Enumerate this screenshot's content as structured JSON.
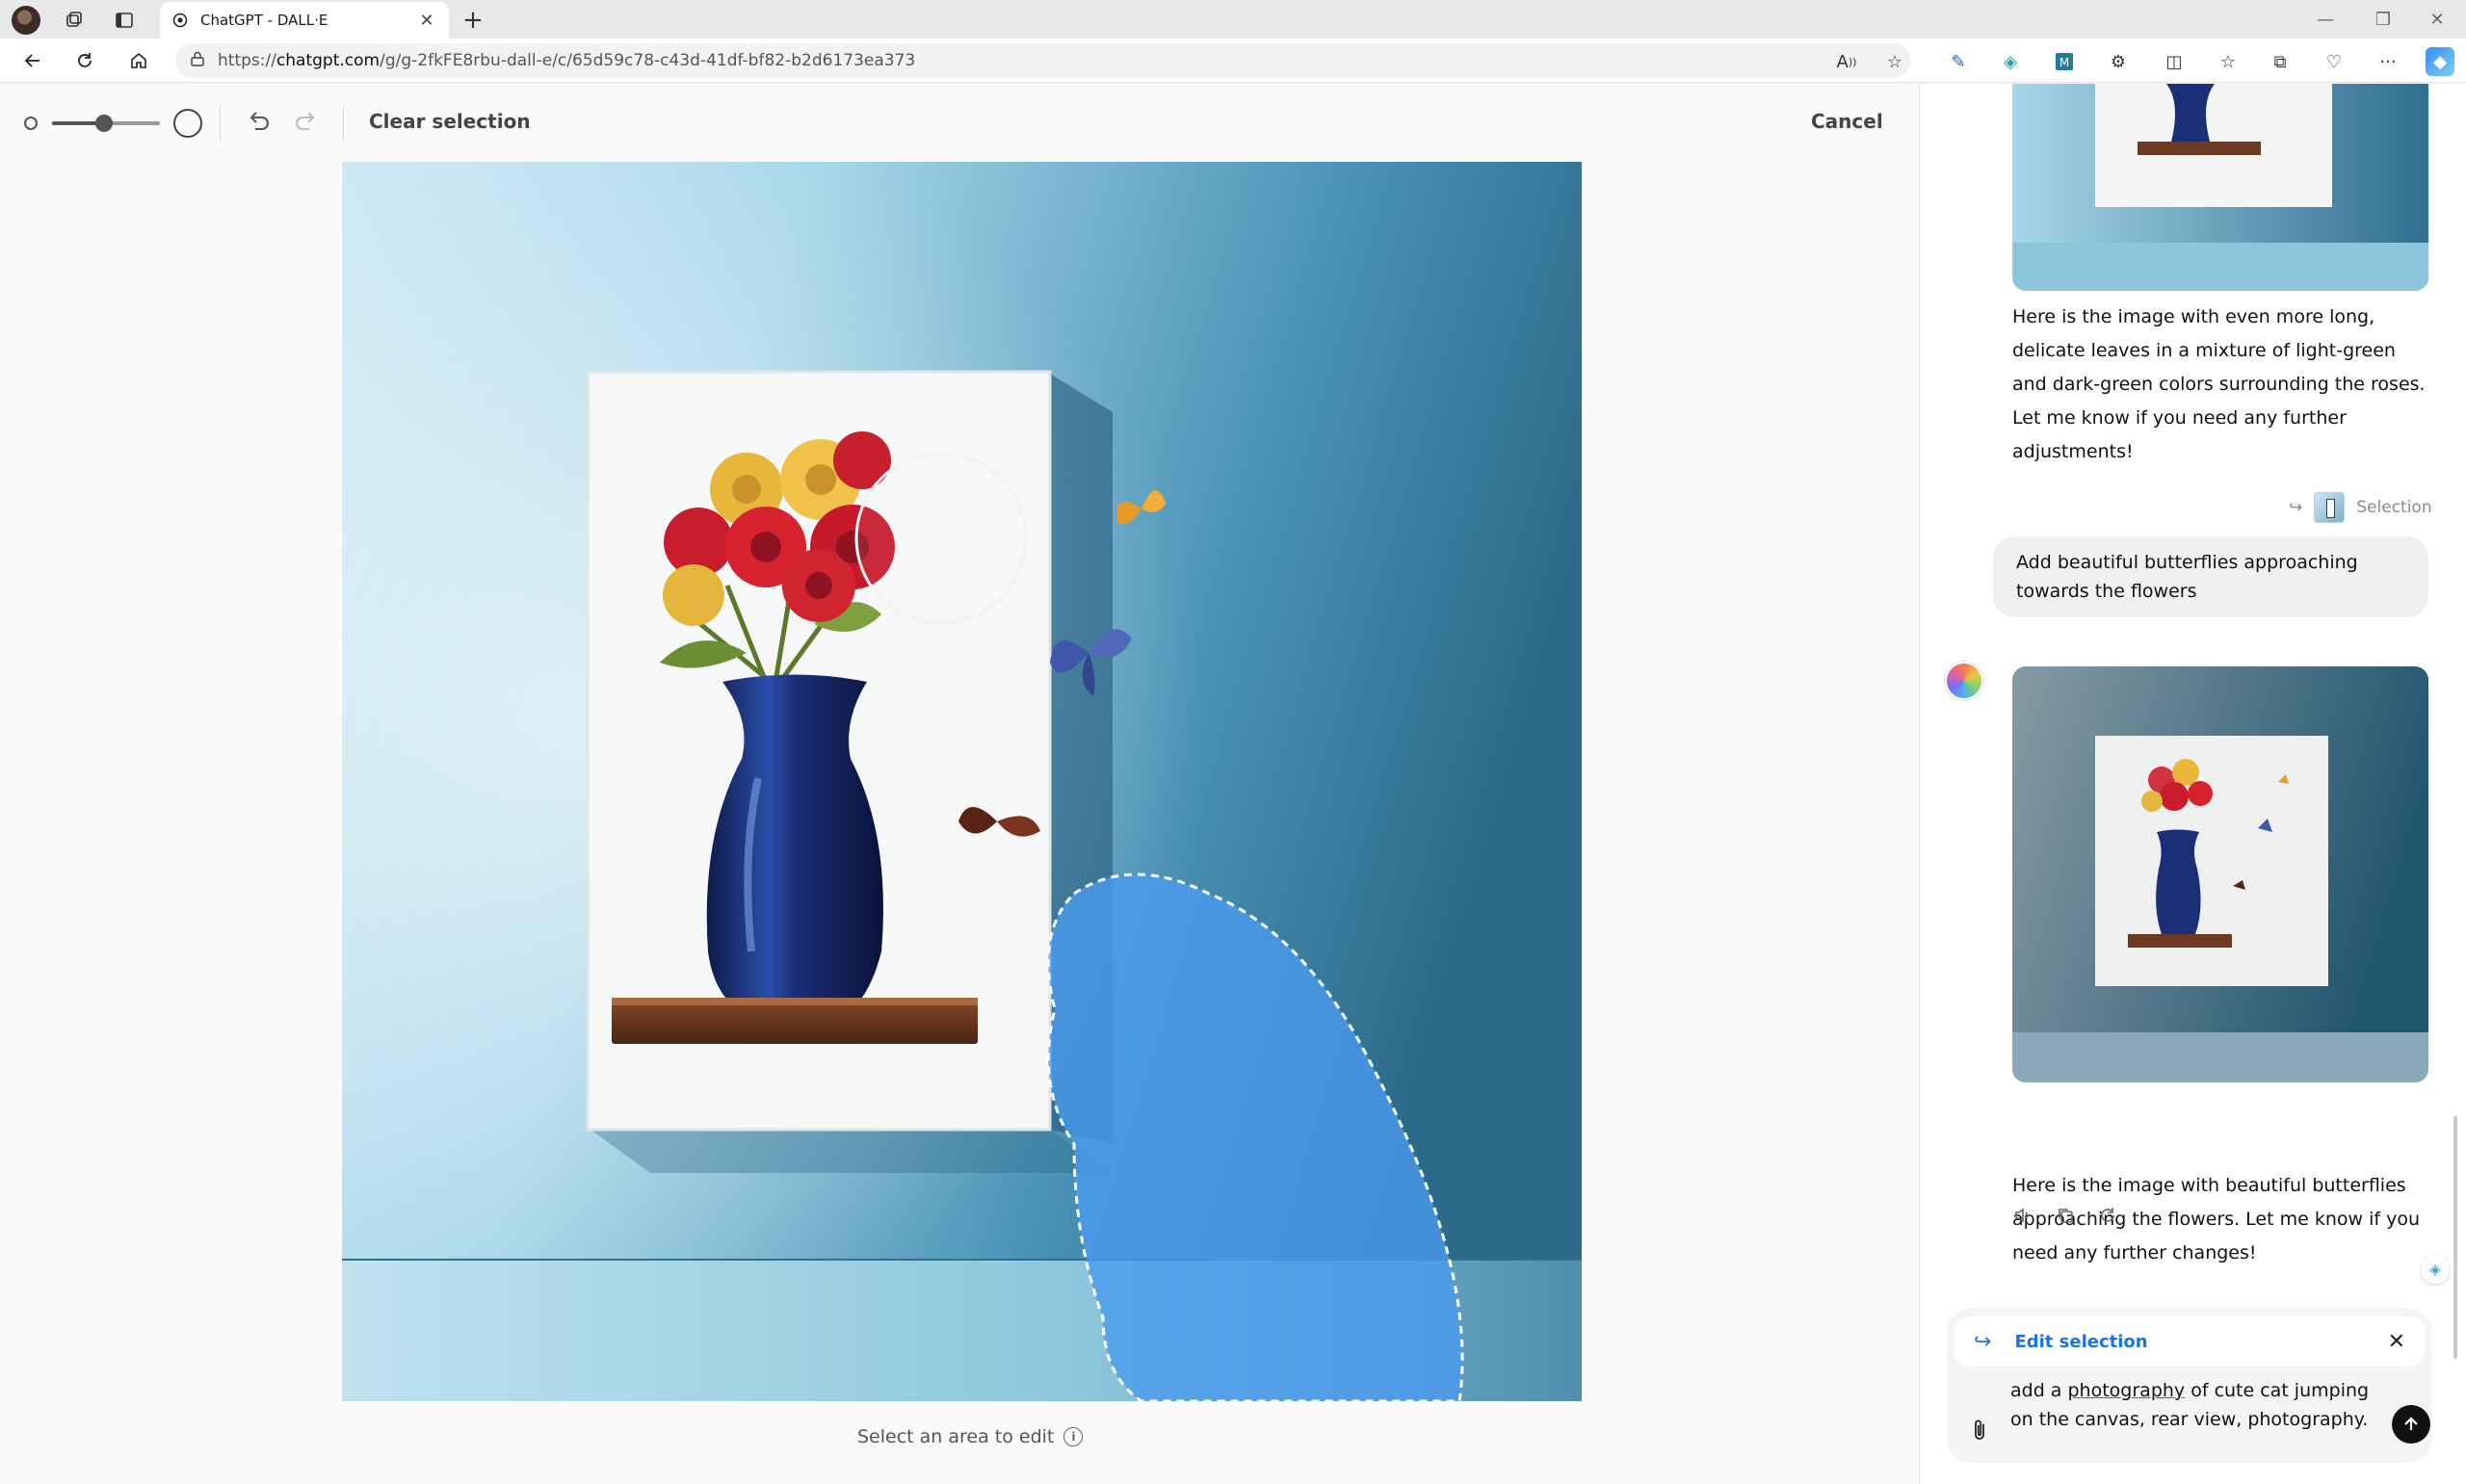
{
  "browser": {
    "tab_title": "ChatGPT - DALL·E",
    "url_prefix": "https://",
    "url_host": "chatgpt.com",
    "url_path": "/g/g-2fkFE8rbu-dall-e/c/65d59c78-c43d-41df-bf82-b2d6173ea373"
  },
  "editor": {
    "clear_selection_label": "Clear selection",
    "cancel_label": "Cancel",
    "hint_text": "Select an area to edit",
    "info_glyph": "i",
    "brush_size_level": 0.48
  },
  "chat": {
    "bot_message_1": "Here is the image with even more long, delicate leaves in a mixture of light-green and dark-green colors surrounding the roses. Let me know if you need any further adjustments!",
    "selection_tag": "Selection",
    "user_message": "Add beautiful butterflies approaching towards the flowers",
    "bot_message_2": "Here is the image with beautiful butterflies approaching the flowers. Let me know if you need any further changes!",
    "action_icons": [
      "speaker-icon",
      "copy-icon",
      "regenerate-icon"
    ]
  },
  "composer": {
    "header_label": "Edit selection",
    "text_before": "add a ",
    "text_underlined": "photography",
    "text_after": " of cute cat jumping on the canvas, rear view, photography."
  },
  "colors": {
    "accent": "#1a73e8",
    "mask": "#4a9bf0",
    "wall_dark": "#2f6f8f",
    "wall_light": "#bfe4f0"
  }
}
